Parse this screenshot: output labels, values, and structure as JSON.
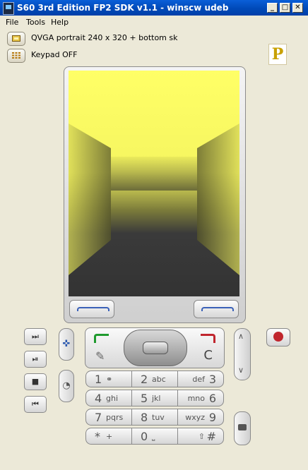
{
  "window": {
    "title": "S60 3rd Edition FP2 SDK v1.1 - winscw udeb",
    "min_label": "_",
    "max_label": "□",
    "close_label": "✕"
  },
  "menu": {
    "items": [
      "File",
      "Tools",
      "Help"
    ]
  },
  "toolbar": {
    "resolution_label": "QVGA portrait 240 x 320 + bottom sk",
    "keypad_label": "Keypad OFF",
    "logo_label": "P"
  },
  "keypad": {
    "clear_label": "C",
    "rows": [
      [
        {
          "n": "1",
          "l": "⚭"
        },
        {
          "n": "2",
          "l": "abc"
        },
        {
          "n": "3",
          "l": "def"
        }
      ],
      [
        {
          "n": "4",
          "l": "ghi"
        },
        {
          "n": "5",
          "l": "jkl"
        },
        {
          "n": "6",
          "l": "mno"
        }
      ],
      [
        {
          "n": "7",
          "l": "pqrs"
        },
        {
          "n": "8",
          "l": "tuv"
        },
        {
          "n": "9",
          "l": "wxyz"
        }
      ],
      [
        {
          "n": "*",
          "l": "+"
        },
        {
          "n": "0",
          "l": "⎵"
        },
        {
          "n": "#",
          "l": "⇧"
        }
      ]
    ]
  },
  "media_buttons": {
    "next_icon": "⏭",
    "play_pause_icon": "⏯",
    "stop_icon": "■",
    "prev_icon": "⏮"
  },
  "colors": {
    "screen_sky": "#ffff66",
    "screen_floor": "#3a3a3a",
    "title_bar": "#0a5fd8",
    "call_green": "#1f9a2e",
    "end_red": "#c0262e"
  }
}
